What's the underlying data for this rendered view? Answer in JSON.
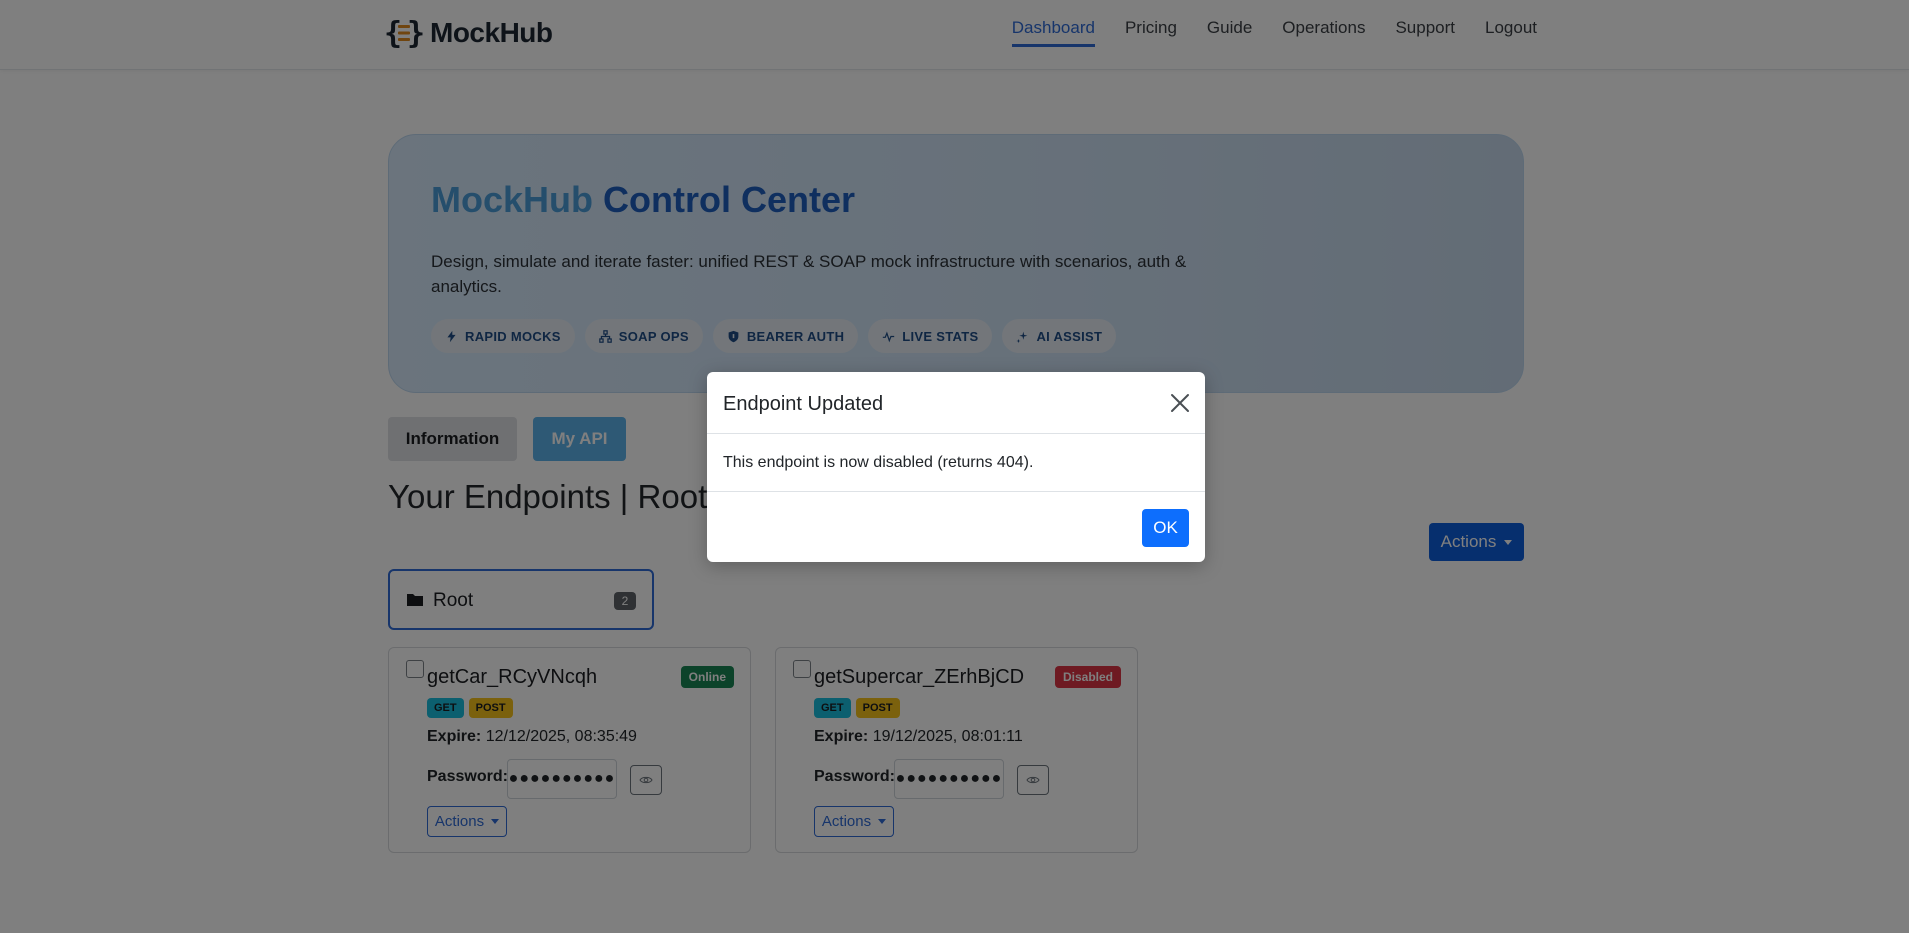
{
  "brand": {
    "name": "MockHub",
    "logo_icon": "braces-logo-icon"
  },
  "nav": {
    "items": [
      {
        "label": "Dashboard",
        "active": true
      },
      {
        "label": "Pricing"
      },
      {
        "label": "Guide"
      },
      {
        "label": "Operations"
      },
      {
        "label": "Support"
      },
      {
        "label": "Logout"
      }
    ]
  },
  "hero": {
    "title_part1": "MockHub",
    "title_part2": "Control Center",
    "description": "Design, simulate and iterate faster: unified REST & SOAP mock infrastructure with scenarios, auth & analytics.",
    "chips": [
      {
        "label": "RAPID MOCKS",
        "icon": "lightning-icon"
      },
      {
        "label": "SOAP OPS",
        "icon": "diagram-icon"
      },
      {
        "label": "BEARER AUTH",
        "icon": "shield-icon"
      },
      {
        "label": "LIVE STATS",
        "icon": "pulse-icon"
      },
      {
        "label": "AI ASSIST",
        "icon": "sparkle-icon"
      }
    ]
  },
  "tabs": {
    "information": "Information",
    "my_api": "My API"
  },
  "page_title": "Your Endpoints | Root",
  "toolbar": {
    "actions_label": "Actions"
  },
  "folder": {
    "name": "Root",
    "count": "2",
    "icon": "folder-icon"
  },
  "endpoints": [
    {
      "name": "getCar_RCyVNcqh",
      "status": "Online",
      "methods": [
        "GET",
        "POST"
      ],
      "expire_label": "Expire:",
      "expire_value": "12/12/2025, 08:35:49",
      "password_label": "Password:",
      "password_mask": "●●●●●●●●●●",
      "actions_label": "Actions"
    },
    {
      "name": "getSupercar_ZErhBjCD",
      "status": "Disabled",
      "methods": [
        "GET",
        "POST"
      ],
      "expire_label": "Expire:",
      "expire_value": "19/12/2025, 08:01:11",
      "password_label": "Password:",
      "password_mask": "●●●●●●●●●●",
      "actions_label": "Actions"
    }
  ],
  "modal": {
    "title": "Endpoint Updated",
    "body": "This endpoint is now disabled (returns 404).",
    "ok_label": "OK"
  },
  "colors": {
    "primary": "#0d6efd",
    "accent": "#2f6bd6",
    "online": "#198754",
    "disabled": "#dc3545",
    "get": "#19bfdf",
    "post": "#f7c21b"
  }
}
